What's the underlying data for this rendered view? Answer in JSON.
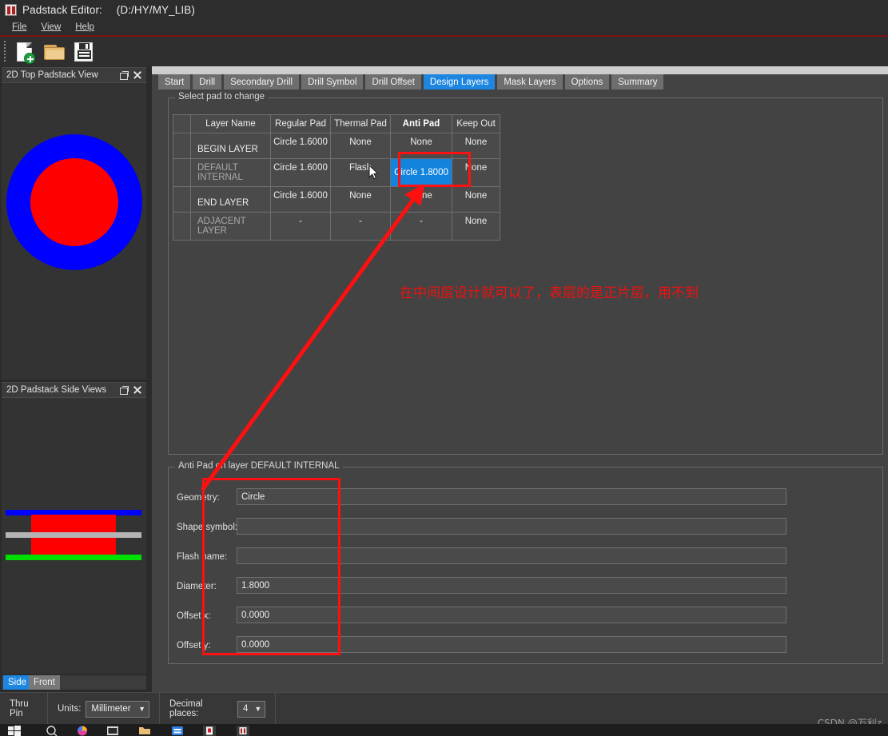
{
  "window": {
    "title": "Padstack Editor:",
    "path": "(D:/HY/MY_LIB)",
    "icon": "padstack-app-icon"
  },
  "menu": [
    {
      "label": "File"
    },
    {
      "label": "View"
    },
    {
      "label": "Help"
    }
  ],
  "toolbar": {
    "buttons": [
      {
        "name": "new-file-button",
        "icon": "new-file-icon",
        "label": "New"
      },
      {
        "name": "open-folder-button",
        "icon": "open-folder-icon",
        "label": "Open"
      },
      {
        "name": "save-button",
        "icon": "save-floppy-icon",
        "label": "Save"
      }
    ]
  },
  "panels": {
    "top_view": {
      "title": "2D Top Padstack View",
      "float_icon": "float-restore-icon",
      "close_icon": "close-icon",
      "graphic": {
        "outer_color": "#0000ff",
        "inner_color": "#ff0000"
      }
    },
    "side_view": {
      "title": "2D Padstack Side Views",
      "float_icon": "float-restore-icon",
      "close_icon": "close-icon",
      "graphic": {
        "top_layer_color": "#0000ff",
        "pad_color": "#ff0000",
        "mid_layer_color": "#b4b4b4",
        "bottom_layer_color": "#00e000"
      },
      "tabs": [
        {
          "label": "Side",
          "selected": true
        },
        {
          "label": "Front",
          "selected": false
        }
      ]
    }
  },
  "tabs": [
    {
      "label": "Start",
      "active": false
    },
    {
      "label": "Drill",
      "active": false
    },
    {
      "label": "Secondary Drill",
      "active": false
    },
    {
      "label": "Drill Symbol",
      "active": false
    },
    {
      "label": "Drill Offset",
      "active": false
    },
    {
      "label": "Design Layers",
      "active": true
    },
    {
      "label": "Mask Layers",
      "active": false
    },
    {
      "label": "Options",
      "active": false
    },
    {
      "label": "Summary",
      "active": false
    }
  ],
  "select_pad_group": {
    "legend": "Select pad to change",
    "table": {
      "headers": [
        "",
        "Layer Name",
        "Regular Pad",
        "Thermal Pad",
        "Anti Pad",
        "Keep Out"
      ],
      "bold_header": "Anti Pad",
      "rows": [
        {
          "layer_name": "BEGIN LAYER",
          "dim": false,
          "regular_pad": "Circle 1.6000",
          "thermal_pad": "None",
          "anti_pad": "None",
          "keep_out": "None",
          "anti_pad_selected": false
        },
        {
          "layer_name": "DEFAULT INTERNAL",
          "dim": true,
          "regular_pad": "Circle 1.6000",
          "thermal_pad": "Flash",
          "anti_pad": "Circle 1.8000",
          "keep_out": "None",
          "anti_pad_selected": true
        },
        {
          "layer_name": "END LAYER",
          "dim": false,
          "regular_pad": "Circle 1.6000",
          "thermal_pad": "None",
          "anti_pad": "None",
          "keep_out": "None",
          "anti_pad_selected": false
        },
        {
          "layer_name": "ADJACENT LAYER",
          "dim": true,
          "regular_pad": "-",
          "thermal_pad": "-",
          "anti_pad": "-",
          "keep_out": "None",
          "anti_pad_selected": false
        }
      ]
    }
  },
  "anti_pad_group": {
    "legend": "Anti Pad on layer DEFAULT INTERNAL",
    "fields": [
      {
        "label": "Geometry:",
        "value": "Circle",
        "name": "geometry-field"
      },
      {
        "label": "Shape symbol:",
        "value": "",
        "name": "shape-symbol-field"
      },
      {
        "label": "Flash name:",
        "value": "",
        "name": "flash-name-field"
      },
      {
        "label": "Diameter:",
        "value": "1.8000",
        "name": "diameter-field"
      },
      {
        "label": "Offset x:",
        "value": "0.0000",
        "name": "offset-x-field"
      },
      {
        "label": "Offset y:",
        "value": "0.0000",
        "name": "offset-y-field"
      }
    ]
  },
  "statusbar": {
    "pin_type": "Thru Pin",
    "units_label": "Units:",
    "units_value": "Millimeter",
    "decimal_label": "Decimal places:",
    "decimal_value": "4",
    "arrow_glyph": "▼"
  },
  "annotations": {
    "note_text": "在中间层设计就可以了，表层的是正片层，用不到",
    "color": "#f01010",
    "highlight_cell": "anti-pad-default-internal",
    "highlight_form": "anti-pad-field-column"
  },
  "watermark": "CSDN @万利z",
  "colors": {
    "accent_blue": "#1c86e0",
    "selection_blue": "#1284dd",
    "annotation_red": "#f01010",
    "window_bg": "#434343",
    "panel_bg": "#333333"
  }
}
